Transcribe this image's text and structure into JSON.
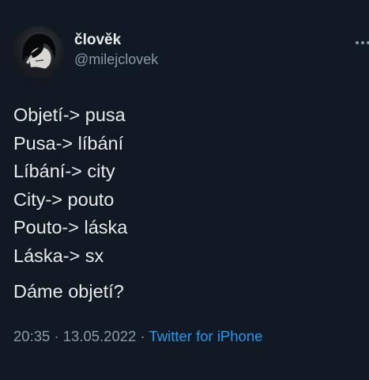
{
  "author": {
    "display_name": "člověk",
    "handle": "@milejclovek"
  },
  "tweet": {
    "lines": [
      "Objetí-> pusa",
      "Pusa-> líbání",
      "Líbání-> city",
      "City-> pouto",
      "Pouto-> láska",
      "Láska-> sx"
    ],
    "question": "Dáme objetí?",
    "time": "20:35",
    "separator_1": "·",
    "date": "13.05.2022",
    "separator_2": "·",
    "source": "Twitter for iPhone"
  },
  "colors": {
    "background": "#111a24",
    "text": "#e7e9ea",
    "secondary_text": "#8b98a5",
    "link": "#1d9bf0"
  },
  "icons": {
    "more": "more-horizontal-icon"
  }
}
